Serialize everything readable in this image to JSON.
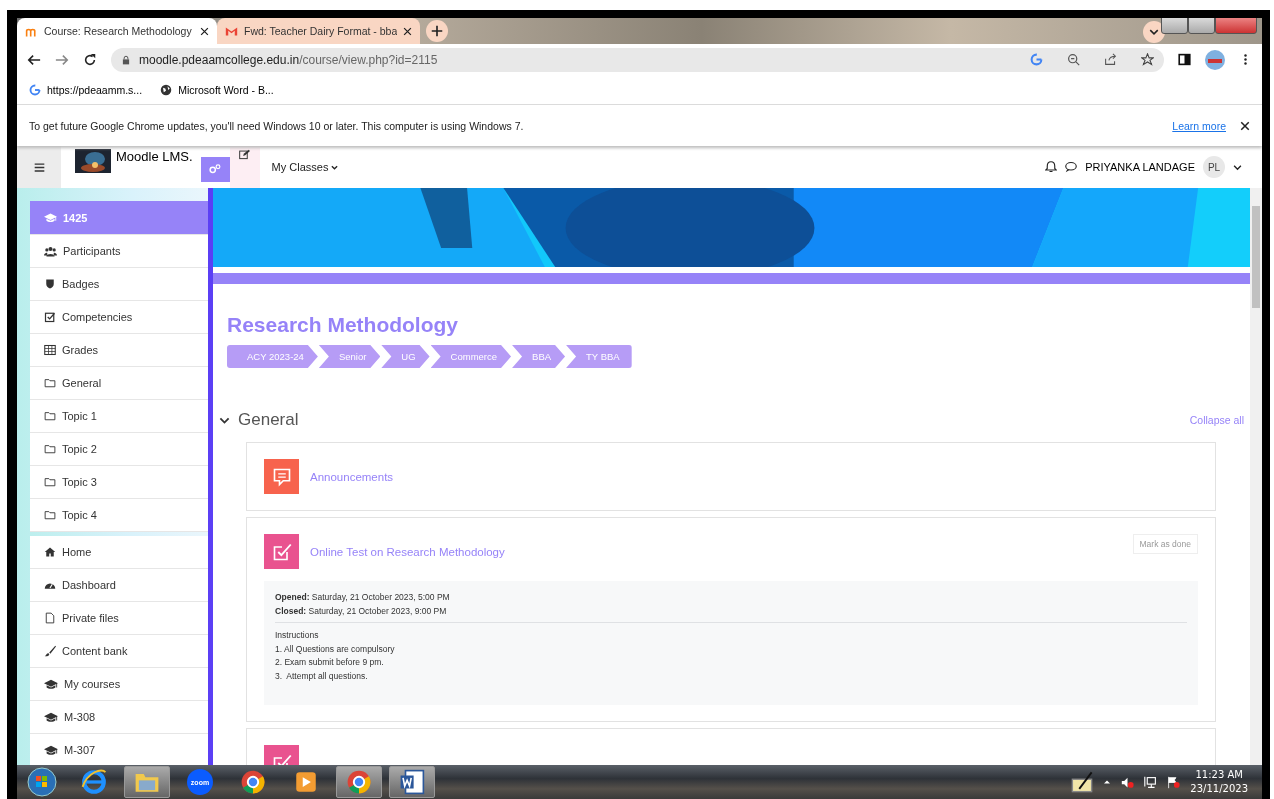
{
  "browser": {
    "tabs": [
      {
        "title": "Course: Research Methodology",
        "selected": true,
        "kind": "moodle"
      },
      {
        "title": "Fwd: Teacher Dairy Format - bba",
        "selected": false,
        "kind": "gmail"
      }
    ],
    "address": {
      "host": "moodle.pdeaamcollege.edu.in",
      "path": "/course/view.php?id=2115"
    },
    "bookmarks": [
      {
        "title": "https://pdeaamm.s...",
        "kind": "google"
      },
      {
        "title": "Microsoft Word - B...",
        "kind": "globe"
      }
    ],
    "infobar": {
      "message": "To get future Google Chrome updates, you'll need Windows 10 or later. This computer is using Windows 7.",
      "link": "Learn more"
    }
  },
  "moodle": {
    "brand": "Moodle LMS.",
    "menu": "My Classes",
    "user": "PRIYANKA LANDAGE",
    "initials": "PL",
    "sidebar": [
      [
        {
          "label": "1425",
          "selected": true
        },
        {
          "label": "Participants",
          "selected": false
        },
        {
          "label": "Badges",
          "selected": false
        },
        {
          "label": "Competencies",
          "selected": false
        },
        {
          "label": "Grades",
          "selected": false
        },
        {
          "label": "General",
          "selected": false
        },
        {
          "label": "Topic 1",
          "selected": false
        },
        {
          "label": "Topic 2",
          "selected": false
        },
        {
          "label": "Topic 3",
          "selected": false
        },
        {
          "label": "Topic 4",
          "selected": false
        }
      ],
      [
        {
          "label": "Home",
          "selected": false
        },
        {
          "label": "Dashboard",
          "selected": false
        },
        {
          "label": "Private files",
          "selected": false
        },
        {
          "label": "Content bank",
          "selected": false
        },
        {
          "label": "My courses",
          "selected": false
        },
        {
          "label": "M-308",
          "selected": false
        },
        {
          "label": "M-307",
          "selected": false
        }
      ]
    ],
    "course": {
      "title": "Research Methodology",
      "breadcrumbs": [
        "ACY 2023-24",
        "Senior",
        "UG",
        "Commerce",
        "BBA",
        "TY BBA"
      ],
      "section": "General",
      "collapse": "Collapse all",
      "activities": [
        {
          "kind": "forum",
          "name": "Announcements"
        },
        {
          "kind": "quiz",
          "name": "Online Test on Research Methodology",
          "button": "Mark as done",
          "dates": [
            {
              "label": "Opened:",
              "value": "Saturday, 21 October 2023, 5:00 PM"
            },
            {
              "label": "Closed:",
              "value": "Saturday, 21 October 2023, 9:00 PM"
            }
          ],
          "instructions": [
            "Instructions",
            "1. All Questions are compulsory",
            "2. Exam submit before 9 pm.",
            "3.  Attempt all questions."
          ]
        },
        {
          "kind": "quiz"
        }
      ]
    }
  },
  "taskbar": {
    "apps": [
      {
        "kind": "ie",
        "open": false
      },
      {
        "kind": "explorer",
        "open": true
      },
      {
        "kind": "zoom",
        "open": false,
        "label": "zoom"
      },
      {
        "kind": "chrome",
        "open": false
      },
      {
        "kind": "media",
        "open": false
      },
      {
        "kind": "chrome",
        "open": true
      },
      {
        "kind": "word",
        "open": true
      }
    ],
    "time": "11:23 AM",
    "date": "23/11/2023"
  }
}
